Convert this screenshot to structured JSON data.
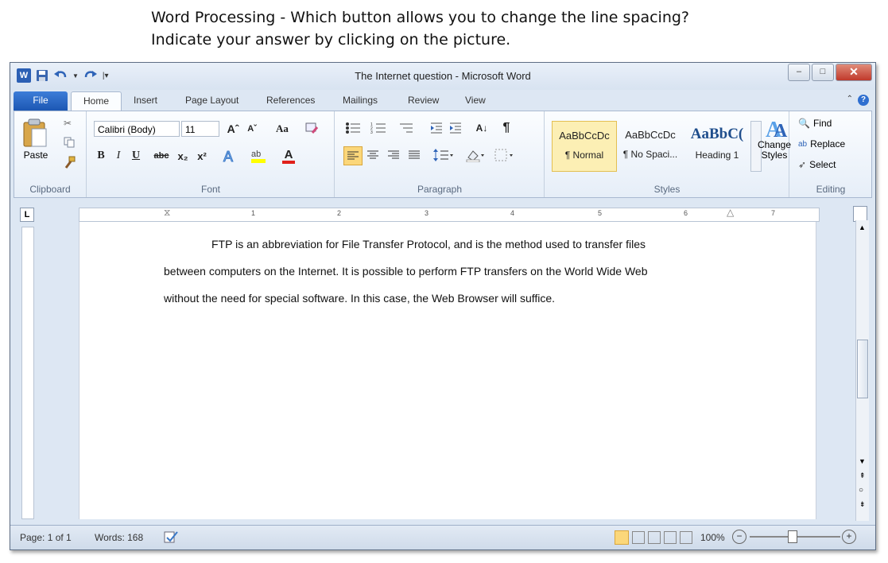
{
  "question": {
    "line1": "Word Processing - Which button allows you to change the line spacing?",
    "line2": "Indicate your answer by clicking on the picture."
  },
  "window": {
    "title": "The Internet question - Microsoft Word",
    "qat": {
      "word_logo": "W"
    },
    "controls": {
      "minimize": "–",
      "maximize": "□",
      "close": "✕"
    }
  },
  "tabs": [
    "File",
    "Home",
    "Insert",
    "Page Layout",
    "References",
    "Mailings",
    "Review",
    "View"
  ],
  "ribbon": {
    "clipboard": {
      "label": "Clipboard",
      "paste": "Paste"
    },
    "font": {
      "label": "Font",
      "font_name": "Calibri (Body)",
      "font_size": "11",
      "grow": "Aˆ",
      "shrink": "Aˇ",
      "case": "Aa",
      "bold": "B",
      "italic": "I",
      "underline": "U",
      "strike": "abc",
      "subscript": "x₂",
      "superscript": "x²",
      "font_color": "A"
    },
    "paragraph": {
      "label": "Paragraph",
      "sort": "A↓",
      "pilcrow": "¶"
    },
    "styles": {
      "label": "Styles",
      "items": [
        {
          "preview": "AaBbCcDc",
          "name": "¶ Normal"
        },
        {
          "preview": "AaBbCcDc",
          "name": "¶ No Spaci..."
        },
        {
          "preview": "AaBbC(",
          "name": "Heading 1"
        }
      ],
      "change_styles": "Change Styles"
    },
    "editing": {
      "label": "Editing",
      "find": "Find",
      "replace": "Replace",
      "select": "Select"
    }
  },
  "ruler": {
    "numbers": [
      "1",
      "2",
      "3",
      "4",
      "5",
      "6",
      "7"
    ]
  },
  "document": {
    "line1": "FTP is an abbreviation for File Transfer Protocol, and is the method used to transfer files",
    "line2": "between computers on the Internet.  It is possible to perform FTP transfers on the World Wide Web",
    "line3": "without the need for special software. In this case, the Web Browser will suffice."
  },
  "status": {
    "page": "Page: 1 of 1",
    "words": "Words: 168",
    "zoom": "100%"
  },
  "colors": {
    "accent": "#1c57b3",
    "ribbon_bg": "#eaf1fa",
    "selected_style": "#fcefb4"
  }
}
